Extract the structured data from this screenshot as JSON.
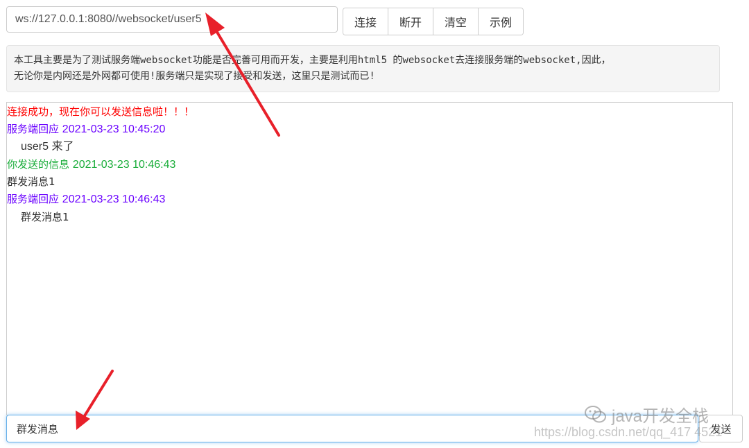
{
  "connection": {
    "url_value": "ws://127.0.0.1:8080//websocket/user5"
  },
  "buttons": {
    "connect": "连接",
    "disconnect": "断开",
    "clear": "清空",
    "example": "示例"
  },
  "info": {
    "line1": "本工具主要是为了测试服务端websocket功能是否完善可用而开发，主要是利用html5 的websocket去连接服务端的websocket,因此，",
    "line2": "无论你是内网还是外网都可使用!服务端只是实现了接受和发送，这里只是测试而已!"
  },
  "messages": {
    "connected": "连接成功，现在你可以发送信息啦！！！",
    "m1_label": "服务端回应",
    "m1_time": "2021-03-23 10:45:20",
    "m1_body": "user5 来了",
    "m2_label": "你发送的信息",
    "m2_time": "2021-03-23 10:46:43",
    "m2_body": "群发消息1",
    "m3_label": "服务端回应",
    "m3_time": "2021-03-23 10:46:43",
    "m3_body": "群发消息1"
  },
  "composer": {
    "input_value": "群发消息",
    "send_label": "发送"
  },
  "watermark": {
    "brand": "java开发全栈",
    "url": "https://blog.csdn.net/qq_417 4521"
  },
  "colors": {
    "success": "#ff0000",
    "server": "#6a00ff",
    "sent": "#1aad3a",
    "arrow": "#e8202a"
  }
}
